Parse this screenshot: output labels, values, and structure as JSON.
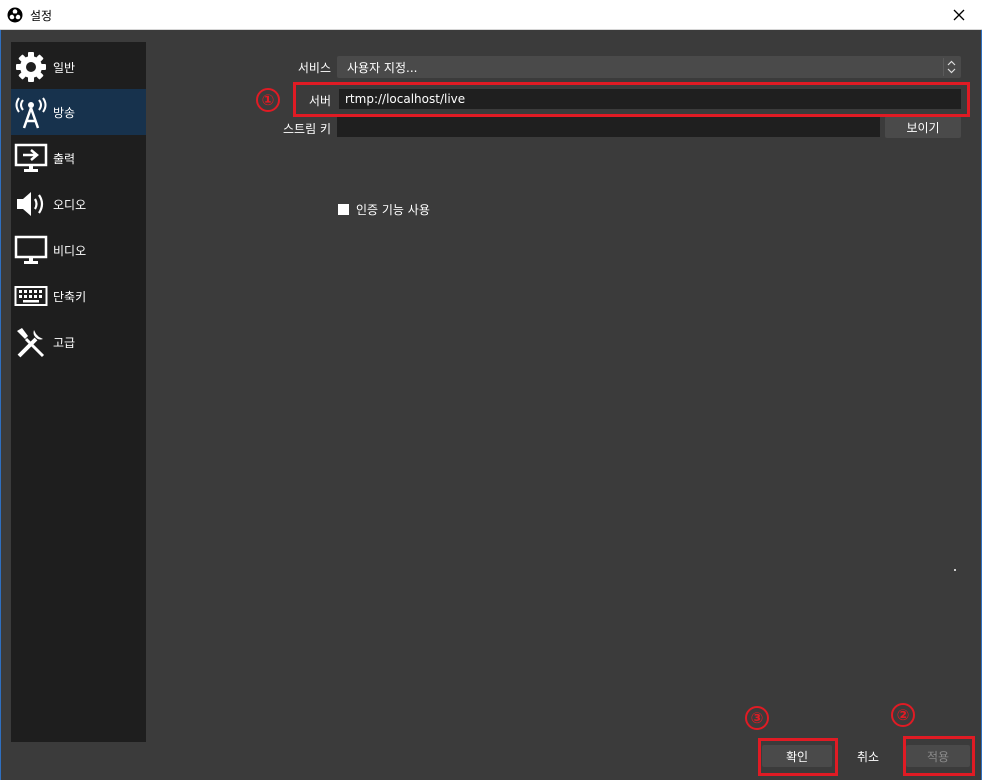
{
  "window": {
    "title": "설정"
  },
  "sidebar": {
    "items": [
      {
        "label": "일반",
        "icon": "gear-icon"
      },
      {
        "label": "방송",
        "icon": "broadcast-antenna-icon",
        "active": true
      },
      {
        "label": "출력",
        "icon": "output-monitor-icon"
      },
      {
        "label": "오디오",
        "icon": "speaker-icon"
      },
      {
        "label": "비디오",
        "icon": "monitor-icon"
      },
      {
        "label": "단축키",
        "icon": "keyboard-icon"
      },
      {
        "label": "고급",
        "icon": "tools-icon"
      }
    ]
  },
  "form": {
    "service_label": "서비스",
    "service_value": "사용자 지정...",
    "server_label": "서버",
    "server_value": "rtmp://localhost/live",
    "stream_key_label": "스트림 키",
    "stream_key_value": "",
    "show_button": "보이기",
    "auth_checkbox_label": "인증 기능 사용"
  },
  "buttons": {
    "ok": "확인",
    "cancel": "취소",
    "apply": "적용"
  },
  "annotations": {
    "one": "①",
    "two": "②",
    "three": "③",
    "color": "#e01b24"
  },
  "colors": {
    "background": "#3b3b3b",
    "sidebar": "#1e1e1e",
    "active_item": "#17324d"
  }
}
